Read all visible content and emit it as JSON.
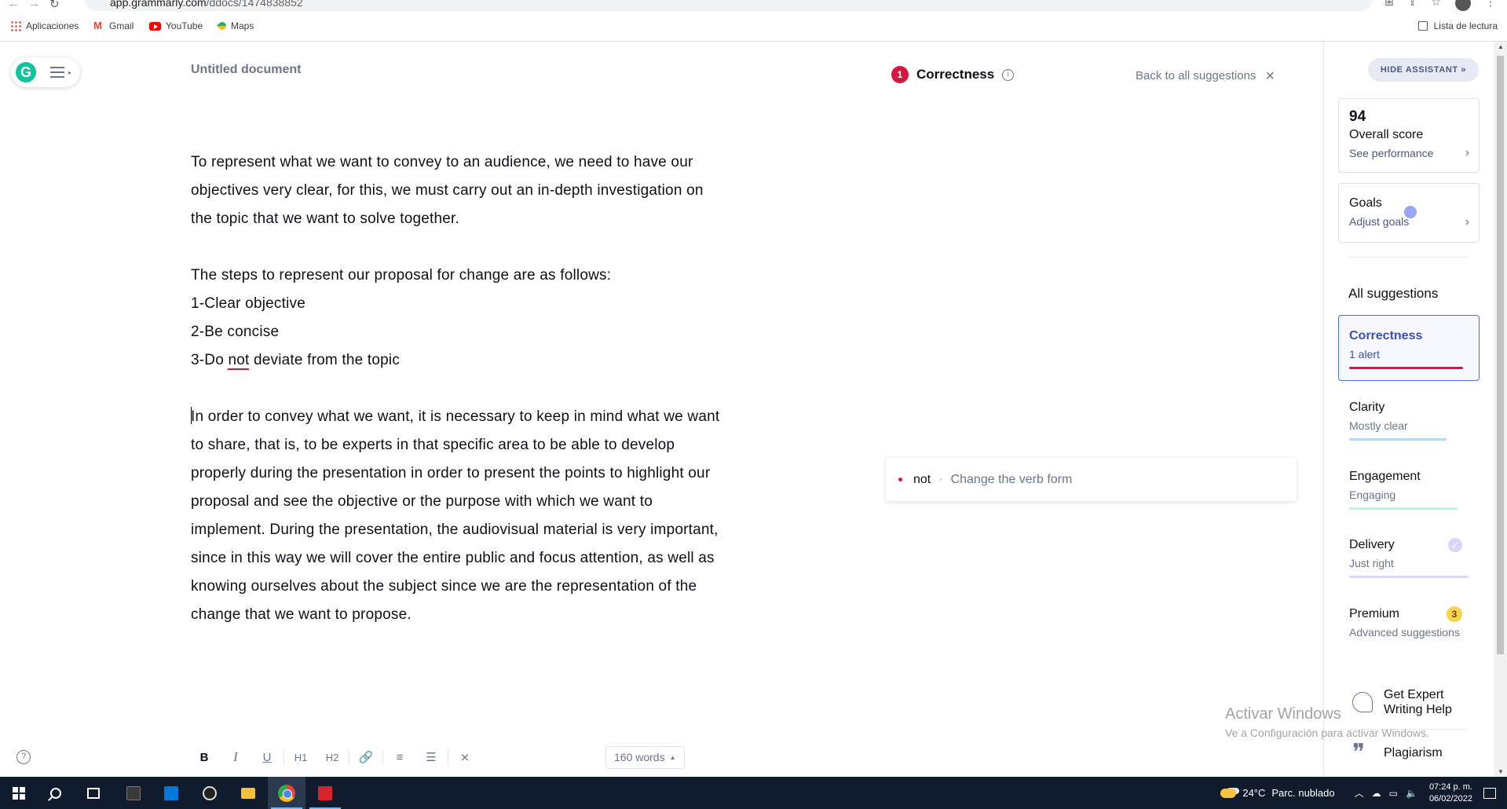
{
  "browser": {
    "url_host": "app.grammarly.com",
    "url_path": "/ddocs/1474838852",
    "bookmarks": [
      "Aplicaciones",
      "Gmail",
      "YouTube",
      "Maps"
    ],
    "reading_list": "Lista de lectura"
  },
  "header": {
    "doc_title": "Untitled document",
    "correctness_count": "1",
    "correctness_label": "Correctness",
    "back_link": "Back to all suggestions"
  },
  "document": {
    "p1": "To represent what we want to convey to an audience, we need to have our objectives very clear, for this, we must carry out an in-depth investigation on the topic that we want to solve together.",
    "p2": "The steps to represent our proposal for change are as follows:",
    "l1": "1-Clear objective",
    "l2": "2-Be concise",
    "l3_pre": "3-Do ",
    "l3_flag": "not",
    "l3_post": " deviate from the topic",
    "p3": "In order to convey what we want, it is necessary to keep in mind what we want to share, that is, to be experts in that specific area to be able to develop properly during the presentation in order to present the points to highlight our proposal and see the objective or the purpose with which we want to implement. During the presentation, the audiovisual material is very important, since in this way we will cover the entire public and focus attention, as well as knowing ourselves about the subject since we are the representation of the change that we want to propose."
  },
  "suggestion": {
    "word": "not",
    "separator": "·",
    "description": "Change the verb form"
  },
  "toolbar": {
    "bold": "B",
    "italic": "I",
    "underline": "U",
    "h1": "H1",
    "h2": "H2",
    "link": "🔗",
    "ordered_list": "≡",
    "bullet_list": "☰",
    "clear": "⨯",
    "word_count": "160 words",
    "help": "?"
  },
  "assistant": {
    "hide_button": "HIDE ASSISTANT »",
    "score": "94",
    "score_label": "Overall score",
    "score_link": "See performance",
    "goals_title": "Goals",
    "goals_link": "Adjust goals",
    "all_suggestions": "All suggestions",
    "categories": [
      {
        "title": "Correctness",
        "subtitle": "1 alert",
        "color": "#d9173e"
      },
      {
        "title": "Clarity",
        "subtitle": "Mostly clear",
        "color": "#4a90e2"
      },
      {
        "title": "Engagement",
        "subtitle": "Engaging",
        "color": "#15c39a"
      },
      {
        "title": "Delivery",
        "subtitle": "Just right",
        "color": "#8e6ff2"
      },
      {
        "title": "Premium",
        "subtitle": "Advanced suggestions",
        "badge": "3"
      }
    ],
    "expert_help": "Get Expert Writing Help",
    "plagiarism": "Plagiarism"
  },
  "watermark": {
    "line1": "Activar Windows",
    "line2": "Ve a Configuración para activar Windows."
  },
  "taskbar": {
    "temperature": "24°C",
    "weather": "Parc. nublado",
    "time": "07:24 p. m.",
    "date": "06/02/2022"
  },
  "colors": {
    "accent": "#d9173e",
    "grammarly_green": "#15c39a",
    "active_blue": "#3b4fb8"
  }
}
